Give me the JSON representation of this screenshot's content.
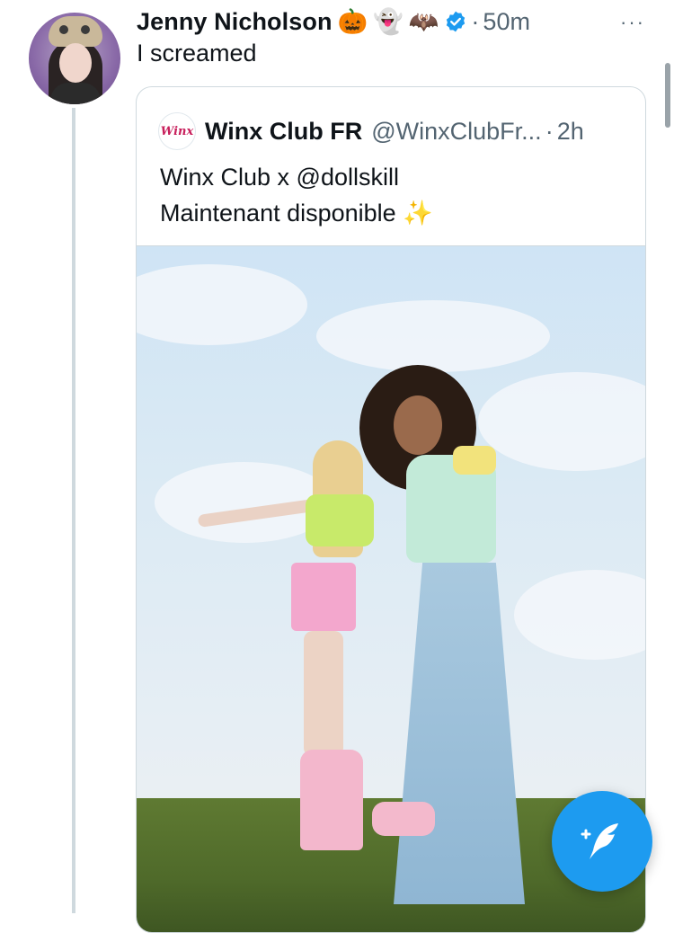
{
  "tweet": {
    "author_name": "Jenny Nicholson",
    "emojis": [
      "🎃",
      "👻",
      "🦇"
    ],
    "separator": "·",
    "time": "50m",
    "more": "···",
    "text": "I screamed"
  },
  "quote": {
    "author_name": "Winx Club FR",
    "handle": "@WinxClubFr...",
    "separator": "·",
    "time": "2h",
    "logo_text": "Winx",
    "text_line1": "Winx Club x @dollskill",
    "text_line2": "Maintenant disponible",
    "sparkles": "✨"
  },
  "fab": {
    "icon": "compose-quill-icon"
  },
  "colors": {
    "accent": "#1d9bf0",
    "thread_line": "#cfd9de",
    "muted": "#536471"
  }
}
